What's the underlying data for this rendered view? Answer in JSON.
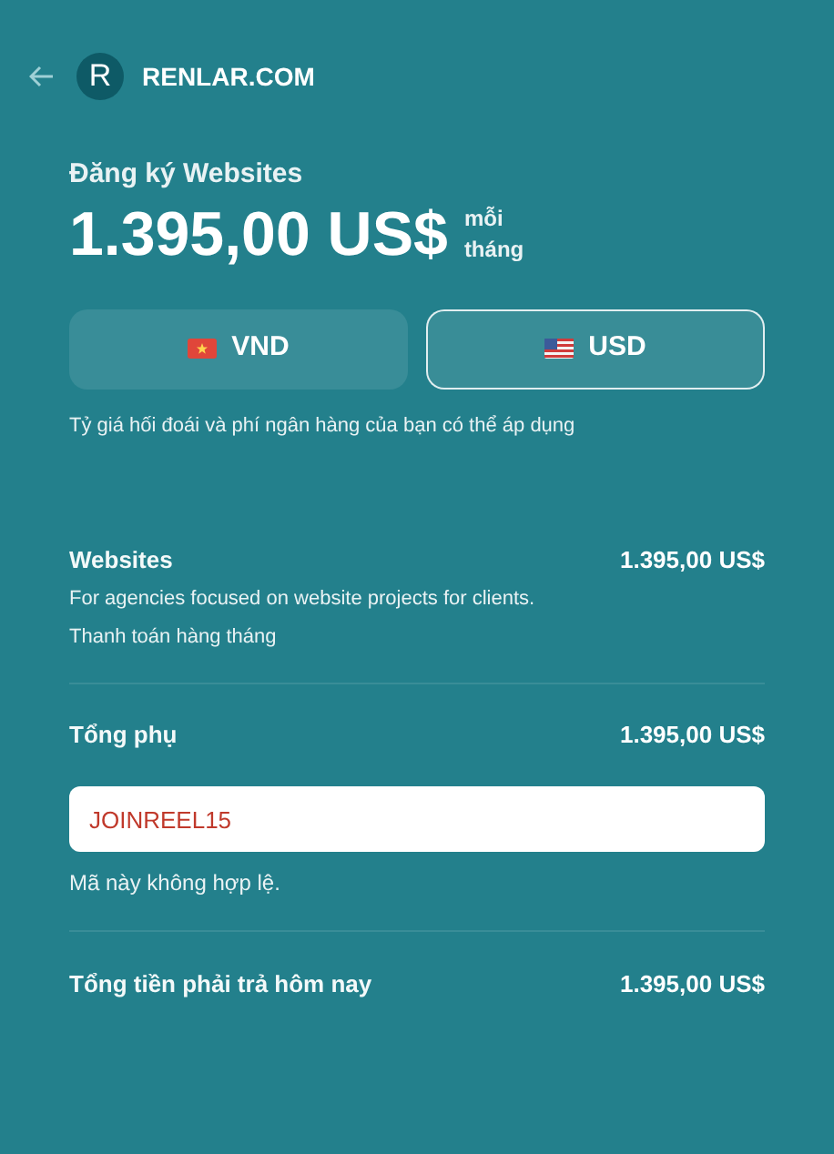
{
  "header": {
    "logo_letter": "R",
    "brand": "RENLAR.COM"
  },
  "plan": {
    "title": "Đăng ký Websites",
    "price": "1.395,00 US$",
    "period_top": "mỗi",
    "period_bottom": "tháng"
  },
  "currencies": [
    {
      "label": "VND",
      "kind": "vn",
      "selected": false
    },
    {
      "label": "USD",
      "kind": "us",
      "selected": true
    }
  ],
  "currency_note": "Tỷ giá hối đoái và phí ngân hàng của bạn có thể áp dụng",
  "line_item": {
    "name": "Websites",
    "description": "For agencies focused on website projects for clients.",
    "billing": "Thanh toán hàng tháng",
    "amount": "1.395,00 US$"
  },
  "subtotal": {
    "label": "Tổng phụ",
    "amount": "1.395,00 US$"
  },
  "promo": {
    "value": "JOINREEL15",
    "invalid": true,
    "message": "Mã này không hợp lệ."
  },
  "total": {
    "label": "Tổng tiền phải trả hôm nay",
    "amount": "1.395,00 US$"
  }
}
